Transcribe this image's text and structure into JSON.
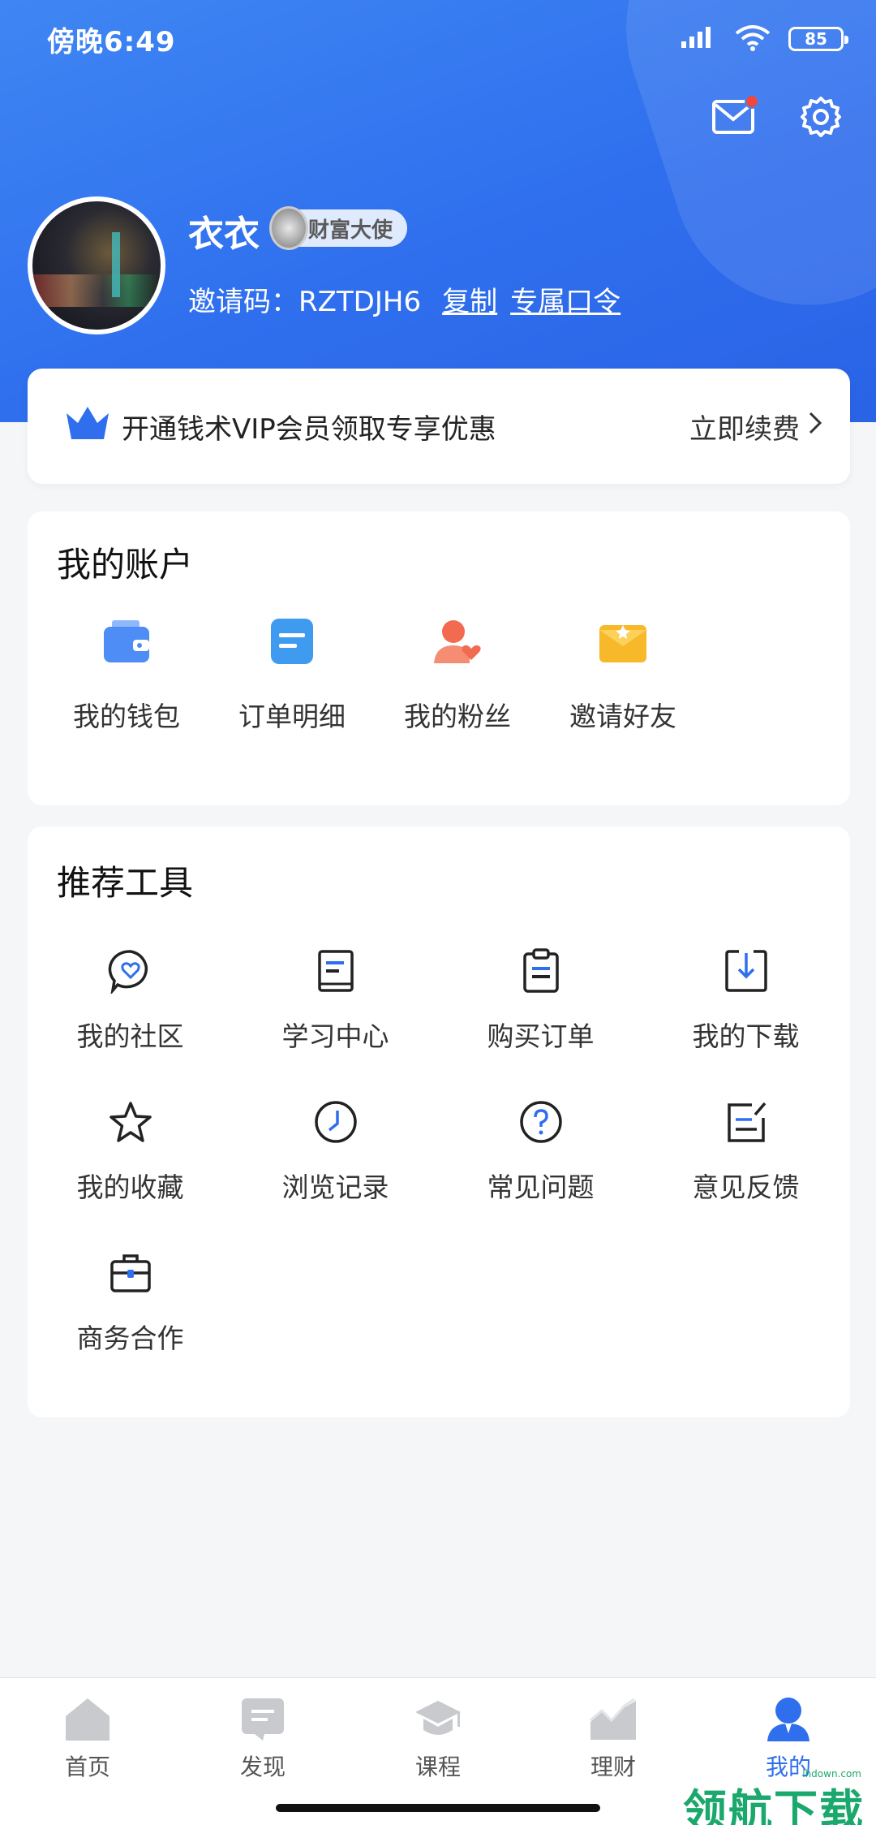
{
  "status_bar": {
    "time": "傍晚6:49",
    "battery": "85"
  },
  "profile": {
    "name": "衣衣",
    "badge": "财富大使",
    "invite_label": "邀请码：RZTDJH6",
    "copy_link": "复制",
    "exclusive_link": "专属口令"
  },
  "vip": {
    "text": "开通钱术VIP会员领取专享优惠",
    "action": "立即续费"
  },
  "account": {
    "title": "我的账户",
    "items": [
      {
        "label": "我的钱包",
        "icon": "wallet-icon",
        "color": "#4d8df5"
      },
      {
        "label": "订单明细",
        "icon": "order-detail-icon",
        "color": "#3f9bf0"
      },
      {
        "label": "我的粉丝",
        "icon": "fans-icon",
        "color": "#f26a4f"
      },
      {
        "label": "邀请好友",
        "icon": "invite-envelope-icon",
        "color": "#f7b92a"
      }
    ]
  },
  "tools": {
    "title": "推荐工具",
    "items": [
      {
        "label": "我的社区",
        "icon": "community-icon"
      },
      {
        "label": "学习中心",
        "icon": "study-book-icon"
      },
      {
        "label": "购买订单",
        "icon": "clipboard-icon"
      },
      {
        "label": "我的下载",
        "icon": "download-icon"
      },
      {
        "label": "我的收藏",
        "icon": "star-icon"
      },
      {
        "label": "浏览记录",
        "icon": "clock-icon"
      },
      {
        "label": "常见问题",
        "icon": "question-icon"
      },
      {
        "label": "意见反馈",
        "icon": "feedback-edit-icon"
      },
      {
        "label": "商务合作",
        "icon": "briefcase-icon"
      }
    ]
  },
  "tabbar": {
    "items": [
      {
        "label": "首页",
        "icon": "home-icon"
      },
      {
        "label": "发现",
        "icon": "discover-icon"
      },
      {
        "label": "课程",
        "icon": "graduation-cap-icon"
      },
      {
        "label": "理财",
        "icon": "finance-chart-icon"
      },
      {
        "label": "我的",
        "icon": "user-icon"
      }
    ],
    "active_color": "#2f6fee"
  },
  "watermark": {
    "text": "领航下载",
    "sub": "lhdown.com"
  }
}
